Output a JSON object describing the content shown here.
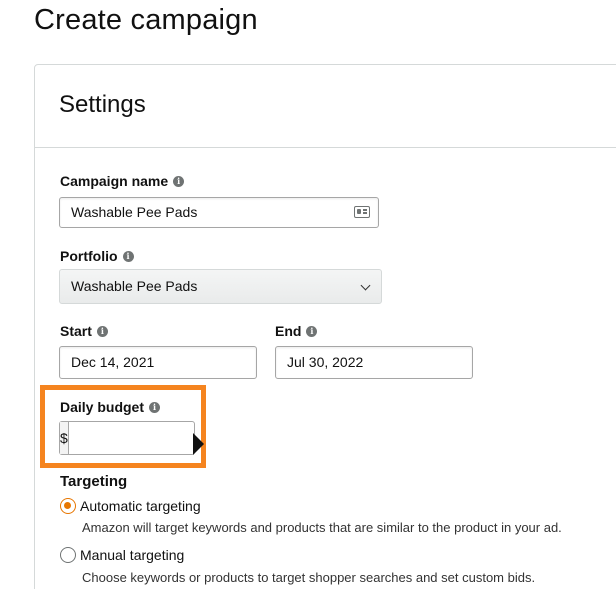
{
  "page": {
    "title": "Create campaign"
  },
  "settings": {
    "title": "Settings",
    "campaign_name": {
      "label": "Campaign name",
      "value": "Washable Pee Pads",
      "icon": "contact-card-icon"
    },
    "portfolio": {
      "label": "Portfolio",
      "selected": "Washable Pee Pads",
      "icon": "chevron-down-icon"
    },
    "start": {
      "label": "Start",
      "value": "Dec 14, 2021"
    },
    "end": {
      "label": "End",
      "value": "Jul 30, 2022"
    },
    "daily_budget": {
      "label": "Daily budget",
      "currency": "$",
      "value": "",
      "highlight_color": "#f5841f"
    },
    "info_icon_glyph": "i",
    "targeting": {
      "label": "Targeting",
      "options": [
        {
          "label": "Automatic targeting",
          "description": "Amazon will target keywords and products that are similar to the product in your ad.",
          "selected": true
        },
        {
          "label": "Manual targeting",
          "description": "Choose keywords or products to target shopper searches and set custom bids.",
          "selected": false
        }
      ]
    }
  },
  "colors": {
    "accent": "#e77600",
    "border": "#d5d9d9",
    "input_border": "#a6a6a6"
  }
}
